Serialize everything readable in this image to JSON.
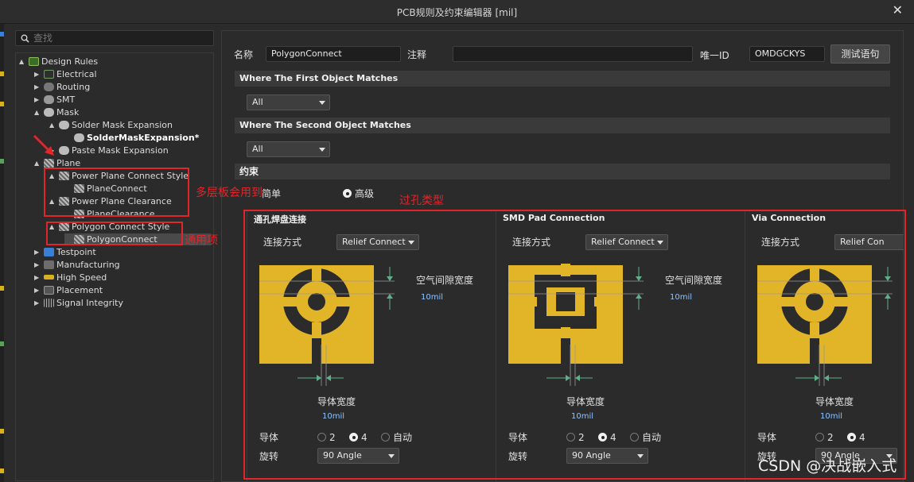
{
  "window": {
    "title": "PCB规则及约束编辑器 [mil]",
    "close_glyph": "✕"
  },
  "search": {
    "placeholder": "查找"
  },
  "tree": [
    {
      "label": "Design Rules",
      "arrow": "▲",
      "level": 0,
      "icon": "design-rules-icon",
      "cls": "ico-rules"
    },
    {
      "label": "Electrical",
      "arrow": "▶",
      "level": 1,
      "icon": "electrical-icon",
      "cls": "ico-elec"
    },
    {
      "label": "Routing",
      "arrow": "▶",
      "level": 1,
      "icon": "routing-icon",
      "cls": "ico-route"
    },
    {
      "label": "SMT",
      "arrow": "▶",
      "level": 1,
      "icon": "smt-icon",
      "cls": "ico-smt"
    },
    {
      "label": "Mask",
      "arrow": "▲",
      "level": 1,
      "icon": "mask-icon",
      "cls": "ico-mask"
    },
    {
      "label": "Solder Mask Expansion",
      "arrow": "▲",
      "level": 2,
      "icon": "mask-icon",
      "cls": "ico-mask"
    },
    {
      "label": "SolderMaskExpansion*",
      "arrow": "",
      "level": 3,
      "icon": "mask-icon",
      "cls": "ico-mask",
      "bold": true
    },
    {
      "label": "Paste Mask Expansion",
      "arrow": "▶",
      "level": 2,
      "icon": "mask-icon",
      "cls": "ico-mask"
    },
    {
      "label": "Plane",
      "arrow": "▲",
      "level": 1,
      "icon": "plane-icon",
      "cls": "ico-plane"
    },
    {
      "label": "Power Plane Connect Style",
      "arrow": "▲",
      "level": 2,
      "icon": "plane-icon",
      "cls": "ico-plane"
    },
    {
      "label": "PlaneConnect",
      "arrow": "",
      "level": 3,
      "icon": "plane-icon",
      "cls": "ico-plane"
    },
    {
      "label": "Power Plane Clearance",
      "arrow": "▲",
      "level": 2,
      "icon": "plane-icon",
      "cls": "ico-plane"
    },
    {
      "label": "PlaneClearance",
      "arrow": "",
      "level": 3,
      "icon": "plane-icon",
      "cls": "ico-plane"
    },
    {
      "label": "Polygon Connect Style",
      "arrow": "▲",
      "level": 2,
      "icon": "plane-icon",
      "cls": "ico-plane"
    },
    {
      "label": "PolygonConnect",
      "arrow": "",
      "level": 3,
      "icon": "plane-icon",
      "cls": "ico-plane",
      "selected": true
    },
    {
      "label": "Testpoint",
      "arrow": "▶",
      "level": 1,
      "icon": "testpoint-icon",
      "cls": "ico-test"
    },
    {
      "label": "Manufacturing",
      "arrow": "▶",
      "level": 1,
      "icon": "manufacturing-icon",
      "cls": "ico-manu"
    },
    {
      "label": "High Speed",
      "arrow": "▶",
      "level": 1,
      "icon": "high-speed-icon",
      "cls": "ico-hs"
    },
    {
      "label": "Placement",
      "arrow": "▶",
      "level": 1,
      "icon": "placement-icon",
      "cls": "ico-place"
    },
    {
      "label": "Signal Integrity",
      "arrow": "▶",
      "level": 1,
      "icon": "signal-integrity-icon",
      "cls": "ico-si"
    }
  ],
  "rule": {
    "name_label": "名称",
    "name_value": "PolygonConnect",
    "comment_label": "注释",
    "comment_value": "",
    "uid_label": "唯一ID",
    "uid_value": "OMDGCKYS",
    "test_button": "测试语句"
  },
  "first_match": {
    "heading": "Where The First Object Matches",
    "value": "All"
  },
  "second_match": {
    "heading": "Where The Second Object Matches",
    "value": "All"
  },
  "constraints": {
    "heading": "约束",
    "mode_simple": "简单",
    "mode_advanced": "高级",
    "mode_selected": "高级",
    "sections": [
      {
        "title": "通孔焊盘连接",
        "connect_label": "连接方式",
        "connect_value": "Relief Connect",
        "air_gap_label": "空气间隙宽度",
        "air_gap_value": "10mil",
        "conductor_width_label": "导体宽度",
        "conductor_width_value": "10mil",
        "conductors_label": "导体",
        "conductor_options": [
          "2",
          "4",
          "自动"
        ],
        "conductors_selected": "4",
        "rotation_label": "旋转",
        "rotation_value": "90 Angle",
        "shape": "round"
      },
      {
        "title": "SMD Pad Connection",
        "connect_label": "连接方式",
        "connect_value": "Relief Connect",
        "air_gap_label": "空气间隙宽度",
        "air_gap_value": "10mil",
        "conductor_width_label": "导体宽度",
        "conductor_width_value": "10mil",
        "conductors_label": "导体",
        "conductor_options": [
          "2",
          "4",
          "自动"
        ],
        "conductors_selected": "4",
        "rotation_label": "旋转",
        "rotation_value": "90 Angle",
        "shape": "square"
      },
      {
        "title": "Via Connection",
        "connect_label": "连接方式",
        "connect_value": "Relief Con",
        "air_gap_label": "",
        "air_gap_value": "",
        "conductor_width_label": "导体宽度",
        "conductor_width_value": "10mil",
        "conductors_label": "导体",
        "conductor_options": [
          "2",
          "4"
        ],
        "conductors_selected": "4",
        "rotation_label": "旋转",
        "rotation_value": "90 Angle",
        "shape": "round"
      }
    ]
  },
  "annotations": {
    "multilayer": "多层板会用到",
    "common": "通用项",
    "via_type": "过孔类型"
  },
  "watermark": "CSDN @决战嵌入式",
  "colors": {
    "accent_red": "#e0262b",
    "copper": "#e2b427",
    "value_blue": "#8fc4ff"
  }
}
